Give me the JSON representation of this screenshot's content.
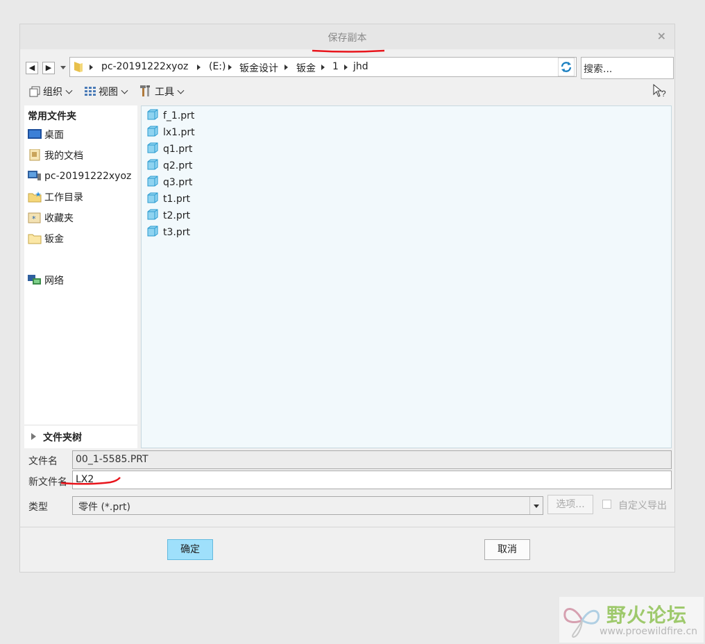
{
  "dialog": {
    "title": "保存副本",
    "close_symbol": "×"
  },
  "navigation": {
    "back_symbol": "◀",
    "forward_symbol": "▶",
    "breadcrumbs": [
      "pc-20191222xyoz",
      "(E:)",
      "钣金设计",
      "钣金",
      "1",
      "jhd"
    ],
    "search_placeholder": "搜索..."
  },
  "toolbar": {
    "organize": "组织",
    "view": "视图",
    "tools": "工具",
    "help_icon": "pointer-help-icon"
  },
  "sidebar": {
    "heading": "常用文件夹",
    "items": [
      {
        "label": "桌面",
        "icon": "desktop-icon"
      },
      {
        "label": "我的文档",
        "icon": "documents-icon"
      },
      {
        "label": "pc-20191222xyoz",
        "icon": "computer-icon"
      },
      {
        "label": "工作目录",
        "icon": "working-folder-icon"
      },
      {
        "label": "收藏夹",
        "icon": "favorites-icon"
      },
      {
        "label": "钣金",
        "icon": "folder-icon"
      },
      {
        "label": "网络",
        "icon": "network-icon"
      }
    ],
    "tree_label": "文件夹树"
  },
  "files": [
    "f_1.prt",
    "lx1.prt",
    "q1.prt",
    "q2.prt",
    "q3.prt",
    "t1.prt",
    "t2.prt",
    "t3.prt"
  ],
  "form": {
    "filename_label": "文件名",
    "filename_value": "00_1-5585.PRT",
    "new_filename_label": "新文件名",
    "new_filename_value": "LX2",
    "type_label": "类型",
    "type_value": "零件 (*.prt)",
    "options_label": "选项...",
    "custom_export_label": "自定义导出"
  },
  "buttons": {
    "ok": "确定",
    "cancel": "取消"
  },
  "watermark": {
    "text": "野火论坛",
    "url": "www.proewildfire.cn"
  },
  "colors": {
    "annotation": "#e8141b",
    "ok_button": "#9fe0fb",
    "file_list_bg": "#f2f9fc"
  }
}
